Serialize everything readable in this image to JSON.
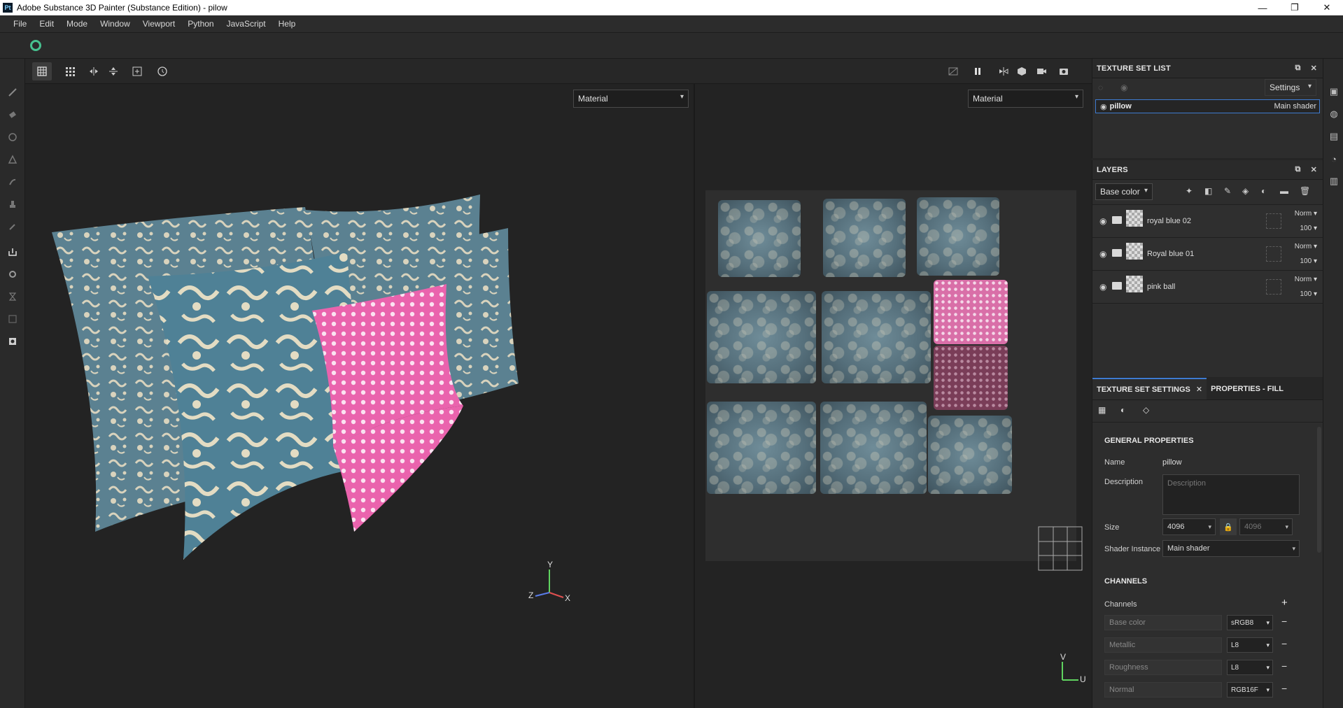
{
  "window": {
    "app_icon_text": "Pt",
    "title": "Adobe Substance 3D Painter (Substance Edition) - pilow",
    "minimize": "—",
    "maximize": "❐",
    "close": "✕"
  },
  "menu": [
    "File",
    "Edit",
    "Mode",
    "Window",
    "Viewport",
    "Python",
    "JavaScript",
    "Help"
  ],
  "viewport3d": {
    "mode_select": "Material",
    "axis_y": "Y",
    "axis_x": "X",
    "axis_z": "Z"
  },
  "viewport2d": {
    "mode_select": "Material",
    "axis_v": "V",
    "axis_u": "U"
  },
  "texture_set_list": {
    "title": "TEXTURE SET LIST",
    "settings_label": "Settings",
    "items": [
      {
        "name": "pillow",
        "shader": "Main shader"
      }
    ]
  },
  "layers": {
    "title": "LAYERS",
    "channel_select": "Base color",
    "items": [
      {
        "name": "royal blue 02",
        "blend": "Norm",
        "opacity": "100"
      },
      {
        "name": "Royal blue 01",
        "blend": "Norm",
        "opacity": "100"
      },
      {
        "name": "pink ball",
        "blend": "Norm",
        "opacity": "100"
      }
    ]
  },
  "tabs": {
    "settings": "TEXTURE SET SETTINGS",
    "properties": "PROPERTIES - FILL"
  },
  "general": {
    "heading": "GENERAL PROPERTIES",
    "name_label": "Name",
    "name_value": "pillow",
    "description_label": "Description",
    "description_placeholder": "Description",
    "size_label": "Size",
    "size_value": "4096",
    "size_value_2": "4096",
    "shader_label": "Shader Instance",
    "shader_value": "Main shader"
  },
  "channels": {
    "heading": "CHANNELS",
    "label": "Channels",
    "add": "+",
    "items": [
      {
        "name": "Base color",
        "format": "sRGB8"
      },
      {
        "name": "Metallic",
        "format": "L8"
      },
      {
        "name": "Roughness",
        "format": "L8"
      },
      {
        "name": "Normal",
        "format": "RGB16F"
      }
    ]
  },
  "colors": {
    "accent": "#3e7bd0",
    "pink": "#d96fa8",
    "blue": "#5f7d8a"
  }
}
